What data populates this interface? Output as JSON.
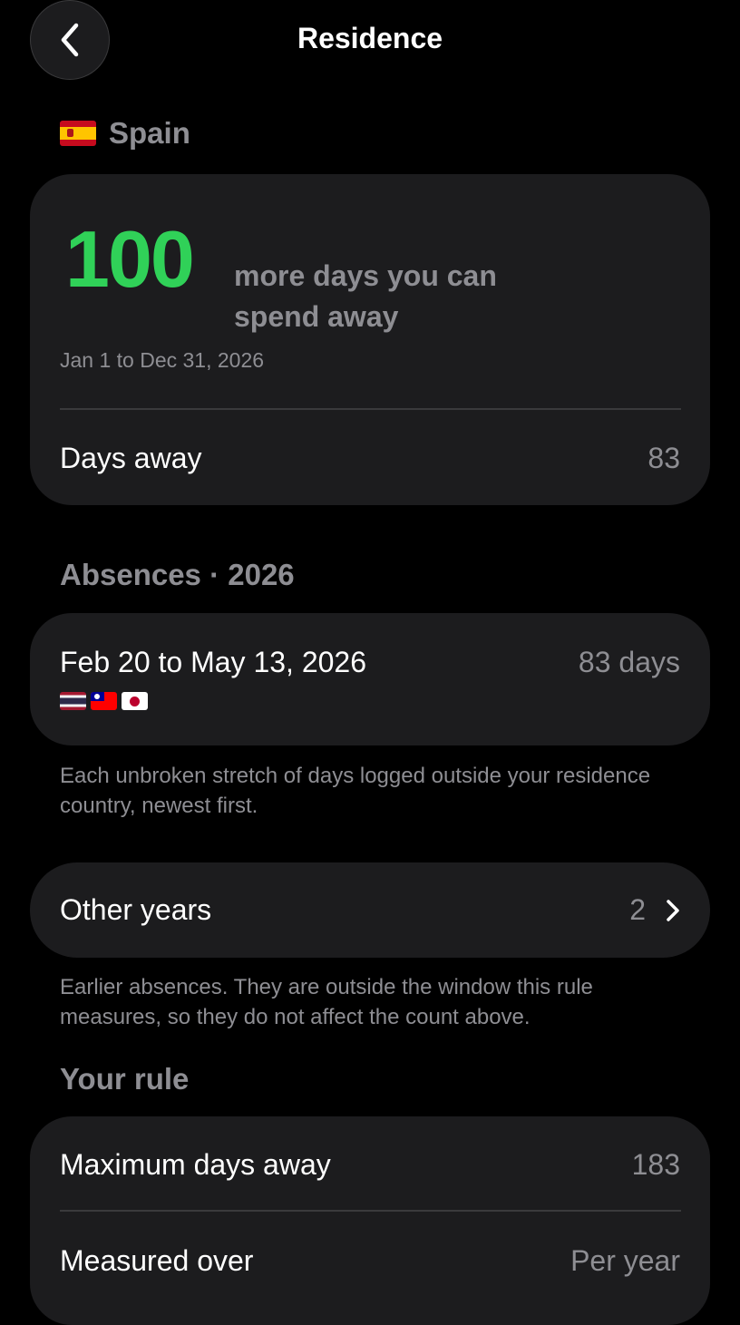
{
  "header": {
    "title": "Residence",
    "back_icon": "chevron-left-icon"
  },
  "country": {
    "name": "Spain",
    "flag_icon": "spain-flag-icon"
  },
  "summary": {
    "remaining_days": "100",
    "remaining_caption": "more days you can spend away",
    "period": "Jan 1 to Dec 31, 2026",
    "days_away_label": "Days away",
    "days_away_value": "83",
    "accent_color": "#30d158"
  },
  "absences": {
    "title": "Absences · 2026",
    "items": [
      {
        "range": "Feb 20 to May 13, 2026",
        "duration": "83 days",
        "flags": [
          "thailand-flag-icon",
          "taiwan-flag-icon",
          "japan-flag-icon"
        ]
      }
    ],
    "note": "Each unbroken stretch of days logged outside your residence country, newest first."
  },
  "other_years": {
    "label": "Other years",
    "count": "2",
    "icon": "chevron-right-icon",
    "note": "Earlier absences. They are outside the window this rule measures, so they do not affect the count above."
  },
  "rule": {
    "title": "Your rule",
    "max_days_label": "Maximum days away",
    "max_days_value": "183",
    "measured_label": "Measured over",
    "measured_value": "Per year"
  }
}
